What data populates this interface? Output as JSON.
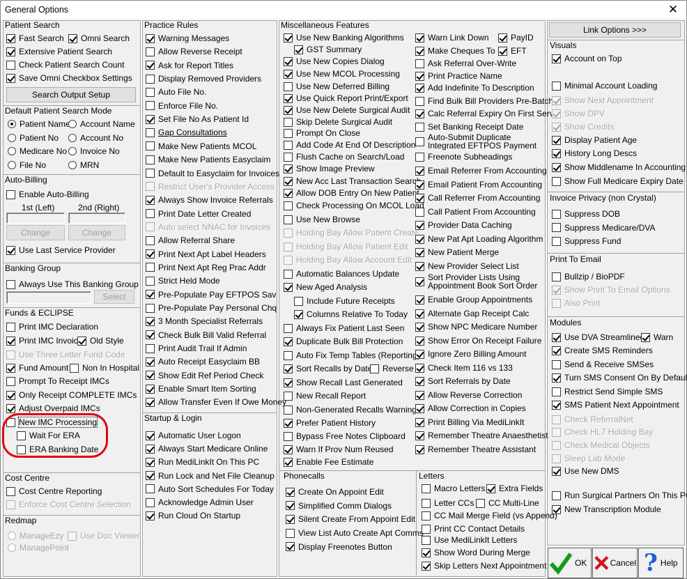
{
  "window": {
    "title": "General Options",
    "close": "✕"
  },
  "patient_search": {
    "title": "Patient Search",
    "button": "Search Output Setup",
    "items": [
      {
        "label": "Fast Search",
        "checked": true
      },
      {
        "label": "Omni Search",
        "checked": true
      },
      {
        "label": "Extensive Patient Search",
        "checked": true
      },
      {
        "label": "Check Patient Search Count",
        "checked": false
      },
      {
        "label": "Save Omni Checkbox Settings",
        "checked": true
      }
    ]
  },
  "default_mode": {
    "title": "Default Patient Search Mode",
    "options": [
      {
        "label": "Patient Name",
        "selected": true
      },
      {
        "label": "Account Name",
        "selected": false
      },
      {
        "label": "Patient No",
        "selected": false
      },
      {
        "label": "Account No",
        "selected": false
      },
      {
        "label": "Medicare No",
        "selected": false
      },
      {
        "label": "Invoice No",
        "selected": false
      },
      {
        "label": "File No",
        "selected": false
      },
      {
        "label": "MRN",
        "selected": false
      }
    ]
  },
  "auto_billing": {
    "title": "Auto-Billing",
    "enable": "Enable Auto-Billing",
    "first": "1st (Left)",
    "second": "2nd (Right)",
    "change": "Change",
    "last_service": "Use Last Service Provider"
  },
  "banking_group": {
    "title": "Banking Group",
    "always": "Always Use This Banking Group",
    "select": "Select"
  },
  "funds": {
    "title": "Funds & ECLIPSE",
    "items": [
      {
        "label": "Print IMC Declaration",
        "checked": false,
        "state": "on"
      },
      {
        "label": "Print IMC Invoice",
        "checked": true,
        "state": "on"
      },
      {
        "label": "Old Style",
        "checked": true,
        "state": "on"
      },
      {
        "label": "Use Three Letter Fund Code",
        "checked": false,
        "state": "dis"
      },
      {
        "label": "Fund Amount",
        "checked": true,
        "state": "on"
      },
      {
        "label": "Non In Hospital",
        "checked": false,
        "state": "on"
      },
      {
        "label": "Prompt To Receipt IMCs",
        "checked": false,
        "state": "on"
      },
      {
        "label": "Only Receipt COMPLETE IMCs",
        "checked": true,
        "state": "on"
      },
      {
        "label": "Adjust Overpaid IMCs",
        "checked": true,
        "state": "on"
      },
      {
        "label": "New IMC Processing",
        "checked": false,
        "state": "on"
      },
      {
        "label": "Wait For ERA",
        "checked": false,
        "state": "on"
      },
      {
        "label": "ERA Banking Date",
        "checked": false,
        "state": "on"
      }
    ]
  },
  "cost_centre": {
    "title": "Cost Centre",
    "items": [
      {
        "label": "Cost Centre Reporting",
        "checked": false,
        "state": "on"
      },
      {
        "label": "Enforce Cost Centre Selection",
        "checked": false,
        "state": "dis"
      }
    ]
  },
  "redmap": {
    "title": "Redmap",
    "items": [
      {
        "label": "ManageEzy"
      },
      {
        "label": "Use Doc Viewer"
      },
      {
        "label": "ManagePoint"
      }
    ]
  },
  "practice_rules": {
    "title": "Practice Rules",
    "items": [
      {
        "label": "Warning Messages",
        "checked": true,
        "state": "on"
      },
      {
        "label": "Allow Reverse Receipt",
        "checked": false,
        "state": "on"
      },
      {
        "label": "Ask for Report Titles",
        "checked": true,
        "state": "on"
      },
      {
        "label": "Display Removed Providers",
        "checked": false,
        "state": "on"
      },
      {
        "label": "Auto File No.",
        "checked": false,
        "state": "on"
      },
      {
        "label": "Enforce File No.",
        "checked": false,
        "state": "on"
      },
      {
        "label": "Set File No As Patient Id",
        "checked": true,
        "state": "on"
      },
      {
        "label": "Gap Consultations",
        "checked": false,
        "state": "ul"
      },
      {
        "label": "Make New Patients MCOL",
        "checked": false,
        "state": "on"
      },
      {
        "label": "Make New Patients Easyclaim",
        "checked": false,
        "state": "on"
      },
      {
        "label": "Default to Easyclaim for Invoices",
        "checked": false,
        "state": "on"
      },
      {
        "label": "Restrict User's Provider Access",
        "checked": false,
        "state": "dis"
      },
      {
        "label": "Always Show Invoice Referrals",
        "checked": true,
        "state": "on"
      },
      {
        "label": "Print Date Letter Created",
        "checked": false,
        "state": "on"
      },
      {
        "label": "Auto select NNAC for Invoices",
        "checked": false,
        "state": "dis"
      },
      {
        "label": "Allow Referral Share",
        "checked": false,
        "state": "on"
      },
      {
        "label": "Print Next Apt Label Headers",
        "checked": true,
        "state": "on"
      },
      {
        "label": "Print Next Apt Reg Prac Addr",
        "checked": false,
        "state": "on"
      },
      {
        "label": "Strict Held Mode",
        "checked": false,
        "state": "on"
      },
      {
        "label": "Pre-Populate Pay EFTPOS Sav",
        "checked": true,
        "state": "on"
      },
      {
        "label": "Pre-Populate Pay Personal Chq",
        "checked": false,
        "state": "on"
      },
      {
        "label": "3 Month Specialist Referrals",
        "checked": true,
        "state": "on"
      },
      {
        "label": "Check Bulk Bill Valid Referral",
        "checked": true,
        "state": "on"
      },
      {
        "label": "Print Audit Trail If Admin",
        "checked": false,
        "state": "on"
      },
      {
        "label": "Auto Receipt Easyclaim BB",
        "checked": true,
        "state": "on"
      },
      {
        "label": "Show Edit Ref Period Check",
        "checked": true,
        "state": "on"
      },
      {
        "label": "Enable Smart Item Sorting",
        "checked": true,
        "state": "on"
      },
      {
        "label": "Allow Transfer Even If Owe Money",
        "checked": true,
        "state": "on"
      }
    ]
  },
  "startup": {
    "title": "Startup & Login",
    "items": [
      {
        "label": "Automatic User Logon",
        "checked": true
      },
      {
        "label": "Always Start Medicare Online",
        "checked": true
      },
      {
        "label": "Run MediLinkIt On This PC",
        "checked": true
      },
      {
        "label": "Run Lock and Net File Cleanup",
        "checked": true
      },
      {
        "label": "Auto Sort Schedules For Today",
        "checked": false
      },
      {
        "label": "Acknowledge Admin User",
        "checked": false
      },
      {
        "label": "Run Cloud On Startup",
        "checked": true
      }
    ]
  },
  "misc": {
    "title": "Miscellaneous Features",
    "col1": [
      {
        "label": "Use New Banking Algorithms",
        "checked": true,
        "state": "on"
      },
      {
        "label": "GST Summary",
        "checked": true,
        "state": "on"
      },
      {
        "label": "Use New Copies Dialog",
        "checked": true,
        "state": "on"
      },
      {
        "label": "Use New MCOL Processing",
        "checked": true,
        "state": "on"
      },
      {
        "label": "Use New Deferred Billing",
        "checked": false,
        "state": "on"
      },
      {
        "label": "Use Quick Report Print/Export",
        "checked": true,
        "state": "on"
      },
      {
        "label": "Use New Delete Surgical Audit",
        "checked": true,
        "state": "on"
      },
      {
        "label": "Skip Delete Surgical Audit",
        "checked": false,
        "state": "on"
      },
      {
        "label": "Prompt On Close",
        "checked": false,
        "state": "on"
      },
      {
        "label": "Add Code At End Of Description",
        "checked": false,
        "state": "on"
      },
      {
        "label": "Flush Cache on Search/Load",
        "checked": false,
        "state": "on"
      },
      {
        "label": "Show Image Preview",
        "checked": true,
        "state": "on"
      },
      {
        "label": "New Acc Last Transaction Search",
        "checked": true,
        "state": "on"
      },
      {
        "label": "Allow DOB Entry On New Patient",
        "checked": true,
        "state": "on"
      },
      {
        "label": "Check Processing On MCOL Load",
        "checked": false,
        "state": "on"
      },
      {
        "label": "Use New Browse",
        "checked": false,
        "state": "on"
      },
      {
        "label": "Holding Bay Allow Patient Create",
        "checked": false,
        "state": "dis"
      },
      {
        "label": "Holding Bay Allow Patient Edit",
        "checked": false,
        "state": "dis"
      },
      {
        "label": "Holding Bay Allow Account Edit",
        "checked": false,
        "state": "dis"
      },
      {
        "label": "Automatic Balances Update",
        "checked": false,
        "state": "on"
      },
      {
        "label": "New Aged Analysis",
        "checked": true,
        "state": "on"
      },
      {
        "label": "Include Future Receipts",
        "checked": false,
        "state": "on"
      },
      {
        "label": "Columns Relative To Today",
        "checked": true,
        "state": "on"
      },
      {
        "label": "Always Fix Patient Last Seen",
        "checked": false,
        "state": "on"
      },
      {
        "label": "Duplicate Bulk Bill Protection",
        "checked": true,
        "state": "on"
      },
      {
        "label": "Auto Fix Temp Tables (Reporting)",
        "checked": false,
        "state": "on"
      },
      {
        "label": "Sort Recalls by Date",
        "checked": true,
        "state": "on"
      },
      {
        "label": "Reverse",
        "checked": false,
        "state": "on"
      },
      {
        "label": "Show Recall Last Generated",
        "checked": true,
        "state": "on"
      },
      {
        "label": "New Recall Report",
        "checked": false,
        "state": "on"
      },
      {
        "label": "Non-Generated Recalls Warning",
        "checked": false,
        "state": "on"
      },
      {
        "label": "Prefer Patient History",
        "checked": true,
        "state": "on"
      },
      {
        "label": "Bypass Free Notes Clipboard",
        "checked": false,
        "state": "on"
      },
      {
        "label": "Warn If Prov Num Reused",
        "checked": true,
        "state": "on"
      },
      {
        "label": "Enable Fee Estimate",
        "checked": true,
        "state": "on"
      }
    ],
    "col2": [
      {
        "label": "Warn Link Down",
        "checked": true
      },
      {
        "label": "PayID",
        "checked": true
      },
      {
        "label": "Make Cheques To",
        "checked": true
      },
      {
        "label": "EFT",
        "checked": true
      },
      {
        "label": "Ask Referral Over-Write",
        "checked": false
      },
      {
        "label": "Print Practice Name",
        "checked": true
      },
      {
        "label": "Add Indefinite To Description",
        "checked": true
      },
      {
        "label": "Find Bulk Bill Providers Pre-Batch",
        "checked": false
      },
      {
        "label": "Calc Referral Expiry On First Serv",
        "checked": true
      },
      {
        "label": "Set Banking Receipt Date",
        "checked": false
      },
      {
        "label": "Auto-Submit Duplicate",
        "label2": "Integrated EFTPOS Payment",
        "checked": false
      },
      {
        "label": "Freenote Subheadings",
        "checked": false
      },
      {
        "label": "Email Referrer From Accounting",
        "checked": true
      },
      {
        "label": "Email Patient From Accounting",
        "checked": true
      },
      {
        "label": "Call Referrer From Accounting",
        "checked": true
      },
      {
        "label": "Call Patient From Accounting",
        "checked": false
      },
      {
        "label": "Provider Data Caching",
        "checked": true
      },
      {
        "label": "New Pat Apt Loading Algorithm",
        "checked": true
      },
      {
        "label": "New Patient Merge",
        "checked": true
      },
      {
        "label": "New Provider Select List",
        "checked": true
      },
      {
        "label": "Sort Provider Lists Using",
        "label2": "Appointment Book Sort Order",
        "checked": true
      },
      {
        "label": "Enable Group Appointments",
        "checked": true
      },
      {
        "label": "Alternate Gap Receipt Calc",
        "checked": true
      },
      {
        "label": "Show NPC Medicare Number",
        "checked": true
      },
      {
        "label": "Show Error On Receipt Failure",
        "checked": true
      },
      {
        "label": "Ignore Zero Billing Amount",
        "checked": true
      },
      {
        "label": "Check Item 116 vs 133",
        "checked": true
      },
      {
        "label": "Sort Referrals by Date",
        "checked": true
      },
      {
        "label": "Allow Reverse Correction",
        "checked": true
      },
      {
        "label": "Allow Correction in Copies",
        "checked": true
      },
      {
        "label": "Print Billing Via MediLinkIt",
        "checked": true
      },
      {
        "label": "Remember Theatre Anaesthetist",
        "checked": true
      },
      {
        "label": "Remember Theatre Assistant",
        "checked": true
      }
    ]
  },
  "phonecalls": {
    "title": "Phonecalls",
    "items": [
      {
        "label": "Create On Appoint Edit",
        "checked": true
      },
      {
        "label": "Simplified Comm Dialogs",
        "checked": true
      },
      {
        "label": "Silent Create From Appoint Edit",
        "checked": true
      },
      {
        "label": "View List Auto Create Apt Comms",
        "checked": false
      },
      {
        "label": "Display Freenotes Button",
        "checked": true
      }
    ]
  },
  "letters": {
    "title": "Letters",
    "items": [
      {
        "label": "Macro Letters",
        "checked": false
      },
      {
        "label": "Extra Fields",
        "checked": true
      },
      {
        "label": "Letter CCs",
        "checked": false
      },
      {
        "label": "CC Multi-Line",
        "checked": false
      },
      {
        "label": "CC Mail Merge Field (vs Append)",
        "checked": false
      },
      {
        "label": "Print CC Contact Details",
        "checked": false
      },
      {
        "label": "Use MediLinkIt Letters",
        "checked": false
      },
      {
        "label": "Show Word During Merge",
        "checked": true
      },
      {
        "label": "Skip Letters Next Appointment",
        "checked": true
      }
    ]
  },
  "link_options": {
    "label": "Link Options >>>"
  },
  "visuals": {
    "title": "Visuals",
    "items": [
      {
        "label": "Account on Top",
        "checked": true,
        "state": "on"
      },
      {
        "label": "Minimal Account Loading",
        "checked": false,
        "state": "on"
      },
      {
        "label": "Show Next Appointment",
        "checked": true,
        "state": "dis"
      },
      {
        "label": "Show DPV",
        "checked": true,
        "state": "dis"
      },
      {
        "label": "Show Credits",
        "checked": true,
        "state": "dis"
      },
      {
        "label": "Display Patient Age",
        "checked": true,
        "state": "on"
      },
      {
        "label": "History Long Descs",
        "checked": true,
        "state": "on"
      },
      {
        "label": "Show Middlename In Accounting",
        "checked": true,
        "state": "on"
      },
      {
        "label": "Show Full Medicare Expiry Date",
        "checked": false,
        "state": "on"
      }
    ]
  },
  "invoice_privacy": {
    "title": "Invoice Privacy (non Crystal)",
    "items": [
      {
        "label": "Suppress DOB",
        "checked": false
      },
      {
        "label": "Suppress Medicare/DVA",
        "checked": false
      },
      {
        "label": "Suppress Fund",
        "checked": false
      }
    ]
  },
  "print_email": {
    "title": "Print To Email",
    "items": [
      {
        "label": "Bullzip / BioPDF",
        "checked": false,
        "state": "on"
      },
      {
        "label": "Show Print To Email Options",
        "checked": true,
        "state": "dis"
      },
      {
        "label": "Also Print",
        "checked": false,
        "state": "dis"
      }
    ]
  },
  "modules": {
    "title": "Modules",
    "items": [
      {
        "label": "Use DVA Streamlined",
        "checked": true,
        "state": "on"
      },
      {
        "label": "Warn",
        "checked": true,
        "state": "on"
      },
      {
        "label": "Create SMS Reminders",
        "checked": true,
        "state": "on"
      },
      {
        "label": "Send & Receive SMSes",
        "checked": false,
        "state": "on"
      },
      {
        "label": "Turn SMS Consent On By Default",
        "checked": true,
        "state": "on"
      },
      {
        "label": "Restrict Send Simple SMS",
        "checked": false,
        "state": "on"
      },
      {
        "label": "SMS Patient Next Appointment",
        "checked": true,
        "state": "on"
      },
      {
        "label": "Check ReferralNet",
        "checked": false,
        "state": "dis"
      },
      {
        "label": "Check HL7 Holding Bay",
        "checked": false,
        "state": "dis"
      },
      {
        "label": "Check Medical Objects",
        "checked": false,
        "state": "dis"
      },
      {
        "label": "Sleep Lab Mode",
        "checked": false,
        "state": "dis"
      },
      {
        "label": "Use New DMS",
        "checked": true,
        "state": "on"
      },
      {
        "label": "Run Surgical Partners On This PC",
        "checked": false,
        "state": "on"
      },
      {
        "label": "New Transcription Module",
        "checked": true,
        "state": "on"
      }
    ]
  },
  "buttons": {
    "ok": "OK",
    "cancel": "Cancel",
    "help": "Help"
  }
}
